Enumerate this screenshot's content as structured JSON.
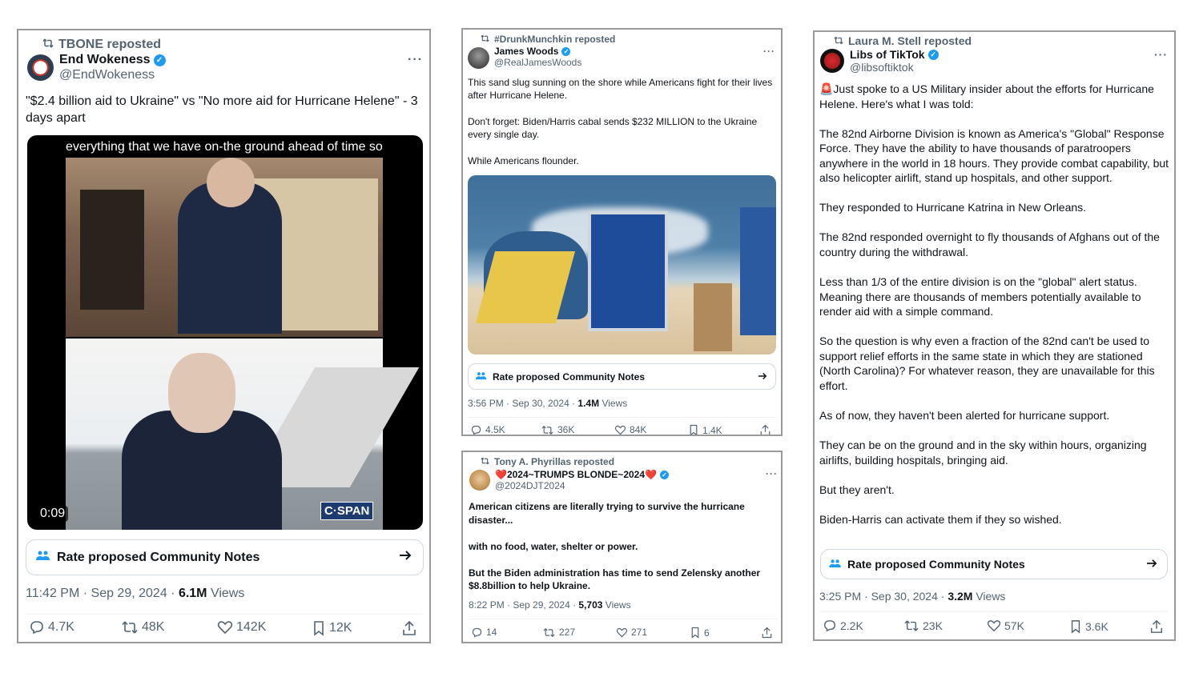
{
  "posts": [
    {
      "repost_text": "TBONE reposted",
      "display_name": "End Wokeness",
      "handle": "@EndWokeness",
      "body": "\"$2.4 billion aid to Ukraine\" vs \"No more aid for Hurricane Helene\" - 3 days apart",
      "video_caption": "everything that we have on-the ground ahead of time so",
      "video_time": "0:09",
      "video_logo": "C·SPAN",
      "community_notes": "Rate proposed Community Notes",
      "timestamp": "11:42 PM · Sep 29, 2024 · ",
      "views_count": "6.1M",
      "views_label": " Views",
      "replies": "4.7K",
      "reposts": "48K",
      "likes": "142K",
      "bookmarks": "12K"
    },
    {
      "repost_text": "#DrunkMunchkin reposted",
      "display_name": "James Woods",
      "handle": "@RealJamesWoods",
      "body": "This sand slug sunning on the shore while Americans fight for their lives after Hurricane Helene.\n\nDon't forget: Biden/Harris cabal sends $232 MILLION to the Ukraine every single day.\n\nWhile Americans flounder.",
      "community_notes": "Rate proposed Community Notes",
      "timestamp": "3:56 PM · Sep 30, 2024 · ",
      "views_count": "1.4M",
      "views_label": " Views",
      "replies": "4.5K",
      "reposts": "36K",
      "likes": "84K",
      "bookmarks": "1.4K"
    },
    {
      "repost_text": "Tony A. Phyrillas reposted",
      "display_name": "❤️2024~TRUMPS BLONDE~2024❤️",
      "handle": "@2024DJT2024",
      "body": "American citizens are literally trying to survive the hurricane disaster...\n\nwith no food, water, shelter or power.\n\nBut the Biden administration has time to send Zelensky another $8.8billion to help Ukraine.",
      "timestamp": "8:22 PM · Sep 29, 2024 · ",
      "views_count": "5,703",
      "views_label": " Views",
      "replies": "14",
      "reposts": "227",
      "likes": "271",
      "bookmarks": "6"
    },
    {
      "repost_text": "Laura M. Stell reposted",
      "display_name": "Libs of TikTok",
      "handle": "@libsoftiktok",
      "body": "🚨Just spoke to a US Military insider about the efforts for Hurricane Helene. Here's what I was told:\n\nThe 82nd Airborne Division is known as America's \"Global\" Response Force. They have the ability to have thousands of paratroopers anywhere in the world in 18 hours. They provide combat capability, but also helicopter airlift, stand up hospitals, and other support.\n\nThey responded to Hurricane Katrina in New Orleans.\n\nThe 82nd responded overnight to fly thousands of Afghans out of the country during the withdrawal.\n\nLess than 1/3 of the entire division is on the \"global\" alert status. Meaning there are thousands of members potentially available to render aid with a simple command.\n\nSo the question is why even a fraction of the 82nd can't be used to support relief efforts in the same state in which they are stationed (North Carolina)? For whatever reason, they are unavailable for this effort.\n\nAs of now, they haven't been alerted for hurricane support.\n\nThey can be on the ground and in the sky within hours, organizing airlifts, building hospitals, bringing aid.\n\nBut they aren't.\n\nBiden-Harris can activate them if they so wished.",
      "community_notes": "Rate proposed Community Notes",
      "timestamp": "3:25 PM · Sep 30, 2024 · ",
      "views_count": "3.2M",
      "views_label": " Views",
      "replies": "2.2K",
      "reposts": "23K",
      "likes": "57K",
      "bookmarks": "3.6K"
    }
  ],
  "icons": [
    "repost-icon",
    "verified-icon",
    "more-icon",
    "community-notes-icon",
    "arrow-right-icon",
    "reply-icon",
    "like-icon",
    "bookmark-icon",
    "share-icon"
  ],
  "colors": {
    "accent": "#1d9bf0",
    "muted": "#536471",
    "text": "#0f1419",
    "border": "#9a9a9a"
  }
}
